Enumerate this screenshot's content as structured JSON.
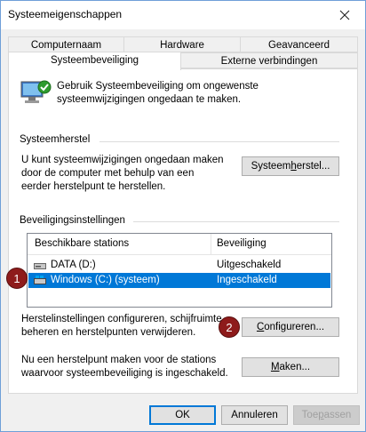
{
  "window": {
    "title": "Systeemeigenschappen"
  },
  "tabs": {
    "row1": [
      "Computernaam",
      "Hardware",
      "Geavanceerd"
    ],
    "row2": [
      "Systeembeveiliging",
      "Externe verbindingen"
    ]
  },
  "intro": {
    "text": "Gebruik Systeembeveiliging om ongewenste systeemwijzigingen ongedaan te maken."
  },
  "restore": {
    "header": "Systeemherstel",
    "description": "U kunt systeemwijzigingen ongedaan maken door de computer met behulp van een eerder herstelpunt te herstellen.",
    "button_prefix": "Systeem",
    "button_underline": "h",
    "button_suffix": "erstel..."
  },
  "protection": {
    "header": "Beveiligingsinstellingen",
    "columns": [
      "Beschikbare stations",
      "Beveiliging"
    ],
    "drives": [
      {
        "name": "DATA (D:)",
        "status": "Uitgeschakeld"
      },
      {
        "name": "Windows (C:) (systeem)",
        "status": "Ingeschakeld"
      }
    ],
    "configure_text": "Herstelinstellingen configureren, schijfruimte beheren en herstelpunten verwijderen.",
    "configure_prefix": "",
    "configure_underline": "C",
    "configure_suffix": "onfigureren...",
    "create_text": "Nu een herstelpunt maken voor de stations waarvoor systeembeveiliging is ingeschakeld.",
    "create_underline": "M",
    "create_suffix": "aken..."
  },
  "badges": [
    "1",
    "2"
  ],
  "footer": {
    "ok": "OK",
    "cancel": "Annuleren",
    "apply_prefix": "Toe",
    "apply_underline": "p",
    "apply_suffix": "assen"
  },
  "colors": {
    "selection": "#0078d7",
    "badge": "#8e1b1b"
  }
}
